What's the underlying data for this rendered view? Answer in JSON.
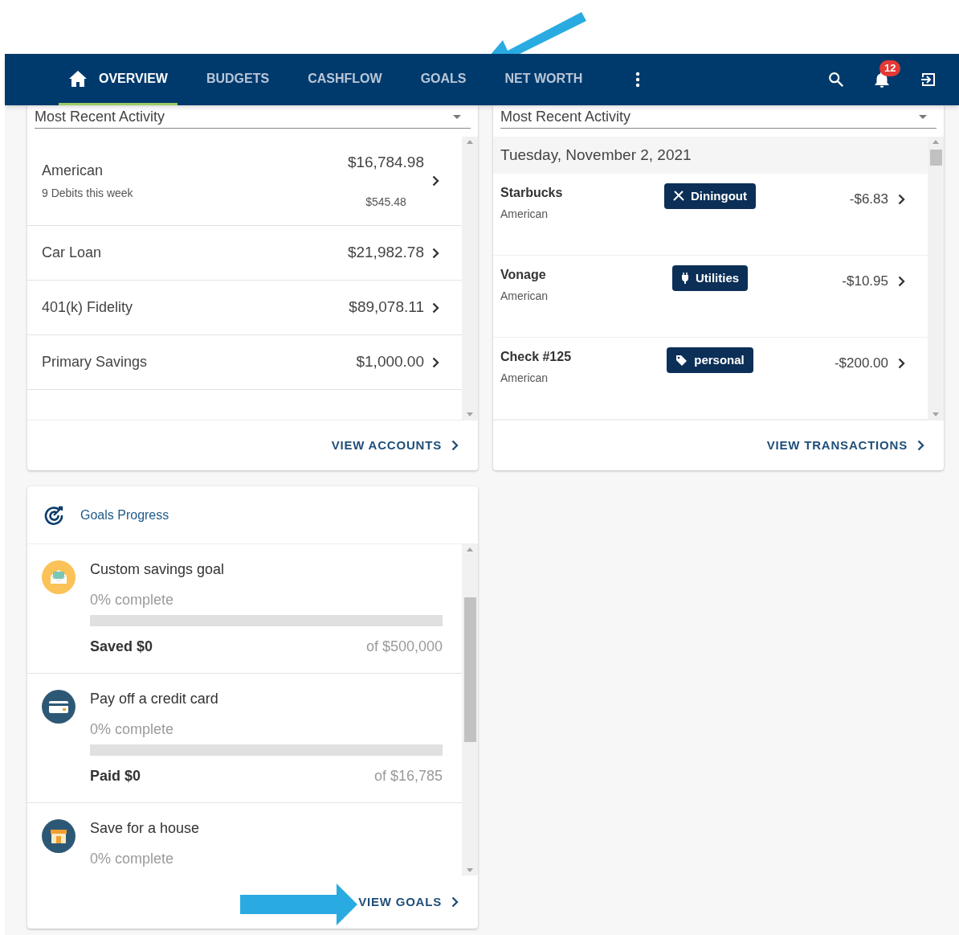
{
  "nav": {
    "tabs": [
      {
        "label": "OVERVIEW",
        "selected": true,
        "kind": "home"
      },
      {
        "label": "BUDGETS",
        "selected": false,
        "kind": "plain"
      },
      {
        "label": "CASHFLOW",
        "selected": false,
        "kind": "plain"
      },
      {
        "label": "GOALS",
        "selected": false,
        "kind": "plain"
      },
      {
        "label": "NET WORTH",
        "selected": false,
        "kind": "plain"
      }
    ],
    "notification_count": "12"
  },
  "accounts_panel": {
    "dropdown": "Most Recent Activity",
    "accounts": [
      {
        "name": "American",
        "subtitle": "9 Debits this week",
        "balance": "$16,784.98",
        "sub_amount": "$545.48"
      },
      {
        "name": "Car Loan",
        "balance": "$21,982.78"
      },
      {
        "name": "401(k) Fidelity",
        "balance": "$89,078.11"
      },
      {
        "name": "Primary Savings",
        "balance": "$1,000.00"
      }
    ],
    "link": "VIEW ACCOUNTS"
  },
  "transactions_panel": {
    "dropdown": "Most Recent Activity",
    "date": "Tuesday, November 2, 2021",
    "transactions": [
      {
        "payee": "Starbucks",
        "account": "American",
        "category": {
          "label": "Diningout",
          "kind": "dining"
        },
        "amount": "-$6.83"
      },
      {
        "payee": "Vonage",
        "account": "American",
        "category": {
          "label": "Utilities",
          "kind": "utilities"
        },
        "amount": "-$10.95"
      },
      {
        "payee": "Check #125",
        "account": "American",
        "category": {
          "label": "personal",
          "kind": "tag"
        },
        "amount": "-$200.00"
      }
    ],
    "link": "VIEW TRANSACTIONS"
  },
  "goals_panel": {
    "title": "Goals Progress",
    "goals": [
      {
        "kind": "savings",
        "name": "Custom savings goal",
        "progress_text": "0% complete",
        "level": 0,
        "amount_text": "Saved $0",
        "target_text": "of $500,000"
      },
      {
        "kind": "credit_card",
        "name": "Pay off a credit card",
        "progress_text": "0% complete",
        "level": 0,
        "amount_text": "Paid $0",
        "target_text": "of $16,785"
      },
      {
        "kind": "house",
        "name": "Save for a house",
        "progress_text": "0% complete"
      }
    ],
    "link": "VIEW GOALS"
  }
}
